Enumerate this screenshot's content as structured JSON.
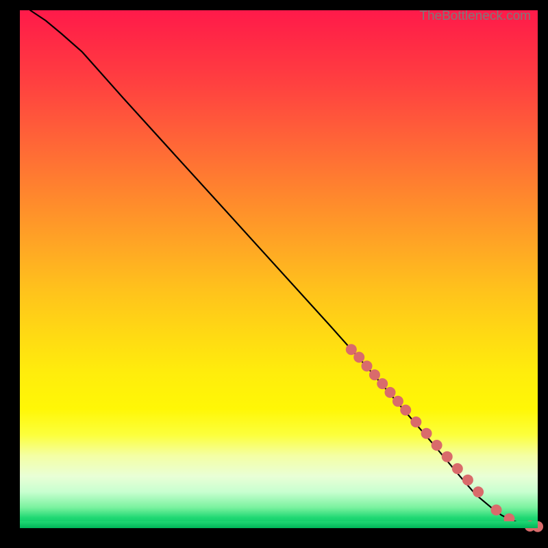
{
  "watermark": "TheBottleneck.com",
  "chart_data": {
    "type": "line",
    "title": "",
    "xlabel": "",
    "ylabel": "",
    "xlim": [
      0,
      100
    ],
    "ylim": [
      0,
      100
    ],
    "grid": false,
    "legend": false,
    "series": [
      {
        "name": "bottleneck-curve",
        "x": [
          2,
          5,
          8,
          12,
          20,
          30,
          40,
          50,
          60,
          68,
          74,
          80,
          85,
          88,
          91,
          93,
          95,
          97,
          99,
          100
        ],
        "y": [
          100,
          98,
          95.5,
          92,
          83,
          72,
          61,
          50,
          39,
          30,
          23,
          16,
          10,
          6.5,
          4,
          2.5,
          1.5,
          0.8,
          0.3,
          0.2
        ]
      }
    ],
    "points": {
      "name": "highlighted-dots",
      "color": "#d96b6b",
      "radius_px": 8,
      "x": [
        64,
        65.5,
        67,
        68.5,
        70,
        71.5,
        73,
        74.5,
        76.5,
        78.5,
        80.5,
        82.5,
        84.5,
        86.5,
        88.5,
        92,
        94.5,
        98.5,
        100
      ],
      "y": [
        34.5,
        33,
        31.3,
        29.6,
        27.9,
        26.2,
        24.5,
        22.8,
        20.5,
        18.3,
        16.0,
        13.8,
        11.5,
        9.3,
        7.0,
        3.5,
        1.8,
        0.4,
        0.3
      ]
    }
  }
}
